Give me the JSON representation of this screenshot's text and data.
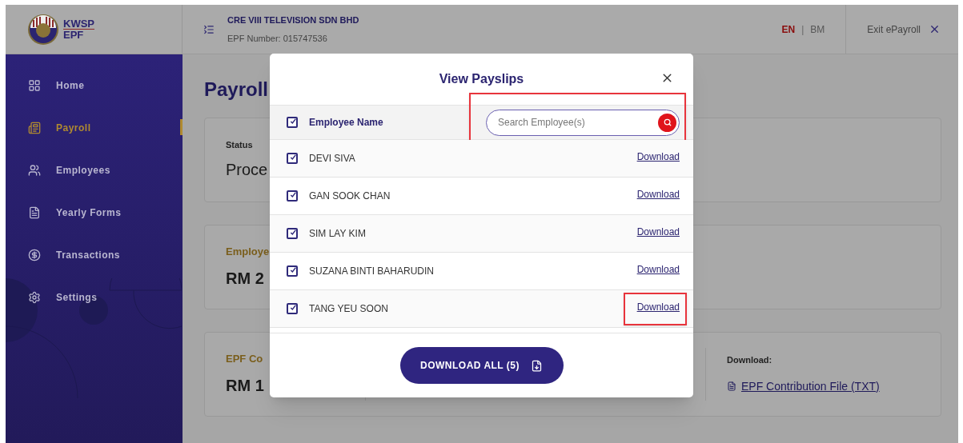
{
  "header": {
    "logo": {
      "line_1": "KWSP",
      "line_2": "EPF"
    },
    "company_name": "CRE VIII TELEVISION SDN BHD",
    "epf_number": "EPF Number: 015747536",
    "languages": [
      {
        "label": "EN",
        "selected": true
      },
      {
        "label": "BM",
        "selected": false
      }
    ],
    "language_separator": "|",
    "exit_label": "Exit ePayroll"
  },
  "sidebar": {
    "items": [
      {
        "label": "Home",
        "selected": false
      },
      {
        "label": "Payroll",
        "selected": true
      },
      {
        "label": "Employees",
        "selected": false
      },
      {
        "label": "Yearly Forms",
        "selected": false
      },
      {
        "label": "Transactions",
        "selected": false
      },
      {
        "label": "Settings",
        "selected": false
      }
    ]
  },
  "page": {
    "title": "Payroll",
    "cards": [
      {
        "label": "Status",
        "value": "Proce",
        "kind": "status"
      },
      {
        "label": "Employe",
        "value": "RM 2",
        "kind": "amount"
      },
      {
        "label": "EPF Co",
        "value": "RM 1",
        "kind": "amount",
        "download_label": "Download:",
        "download_link": "EPF Contribution File (TXT)"
      }
    ]
  },
  "modal": {
    "title": "View Payslips",
    "header": {
      "label": "Employee Name",
      "checked": true
    },
    "search": {
      "placeholder": "Search Employee(s)",
      "highlighted": true
    },
    "rows": [
      {
        "name": "DEVI SIVA",
        "checked": true,
        "link": "Download",
        "highlighted": false
      },
      {
        "name": "GAN SOOK CHAN",
        "checked": true,
        "link": "Download",
        "highlighted": false
      },
      {
        "name": "SIM LAY KIM",
        "checked": true,
        "link": "Download",
        "highlighted": false
      },
      {
        "name": "SUZANA BINTI BAHARUDIN",
        "checked": true,
        "link": "Download",
        "highlighted": false
      },
      {
        "name": "TANG YEU SOON",
        "checked": true,
        "link": "Download",
        "highlighted": true
      }
    ],
    "download_all": "DOWNLOAD ALL (5)"
  }
}
